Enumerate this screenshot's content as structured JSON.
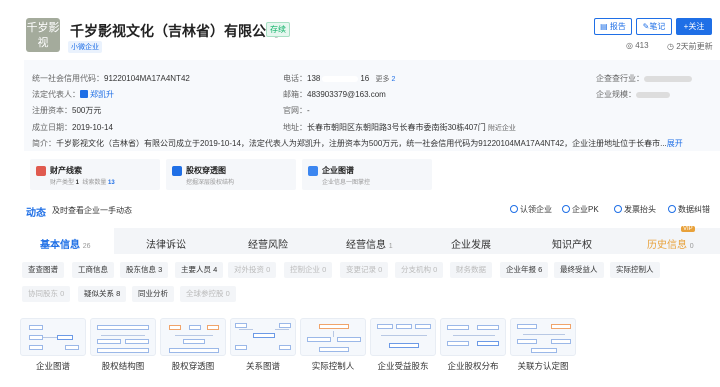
{
  "company": {
    "logo_text": "千岁影视",
    "name": "千岁影视文化（吉林省）有限公司",
    "status": "存续",
    "size_tag": "小微企业",
    "views": "413",
    "updated": "2天前更新"
  },
  "actions": {
    "report": "报告",
    "note": "笔记",
    "follow": "关注"
  },
  "info": {
    "credit_code_label": "统一社会信用代码：",
    "credit_code": "91220104MA17A4NT42",
    "legal_rep_label": "法定代表人：",
    "legal_rep": "郑凯升",
    "capital_label": "注册资本：",
    "capital": "500万元",
    "founded_label": "成立日期：",
    "founded": "2019-10-14",
    "phone_label": "电话：",
    "phone_prefix": "138",
    "phone_suffix": "16",
    "more_label": "更多",
    "more_count": "2",
    "email_label": "邮箱：",
    "email": "483903379@163.com",
    "website_label": "官网：",
    "website": "-",
    "address_label": "地址：",
    "address": "长春市朝阳区东朝阳路3号长春市委南街30栋407门",
    "nearby": "附近企业",
    "industry_label": "企查查行业：",
    "scale_label": "企业规模：",
    "intro_label": "简介：",
    "intro": "千岁影视文化（吉林省）有限公司成立于2019-10-14，法定代表人为郑凯升，注册资本为500万元，统一社会信用代码为91220104MA17A4NT42，企业注册地址位于长春市...",
    "expand": "展开"
  },
  "cards": [
    {
      "title": "财产线索",
      "sub": "财产类型 1  线索数量 13"
    },
    {
      "title": "股权穿透图",
      "sub": "挖掘深层股权结构"
    },
    {
      "title": "企业图谱",
      "sub": "企业信息一图掌控"
    }
  ],
  "dynamics": {
    "title": "动态",
    "sub": "及时查看企业一手动态",
    "links": [
      "认领企业",
      "企业PK",
      "发票抬头",
      "数据纠错"
    ]
  },
  "tabs": [
    {
      "label": "基本信息",
      "count": "26"
    },
    {
      "label": "法律诉讼",
      "count": ""
    },
    {
      "label": "经营风险",
      "count": ""
    },
    {
      "label": "经营信息",
      "count": "1"
    },
    {
      "label": "企业发展",
      "count": ""
    },
    {
      "label": "知识产权",
      "count": ""
    },
    {
      "label": "历史信息",
      "count": "0"
    }
  ],
  "vip_badge": "VIP",
  "chips_row1": [
    "查查图谱",
    "工商信息",
    "股东信息 3",
    "主要人员 4",
    "对外投资 0",
    "控制企业 0",
    "变更记录 0",
    "分支机构 0",
    "财务数据",
    "企业年报 6",
    "最终受益人",
    "实际控制人"
  ],
  "chips_row2": [
    "协同股东 0",
    "疑似关系 8",
    "同业分析",
    "全球参控股 0"
  ],
  "thumbs": [
    "企业图谱",
    "股权结构图",
    "股权穿透图",
    "关系图谱",
    "实际控制人",
    "企业受益股东",
    "企业股权分布",
    "关联方认定图"
  ],
  "colors": {
    "accent": "#1f6fe6",
    "status_green": "#13b36a",
    "history_orange": "#e8a13a"
  }
}
